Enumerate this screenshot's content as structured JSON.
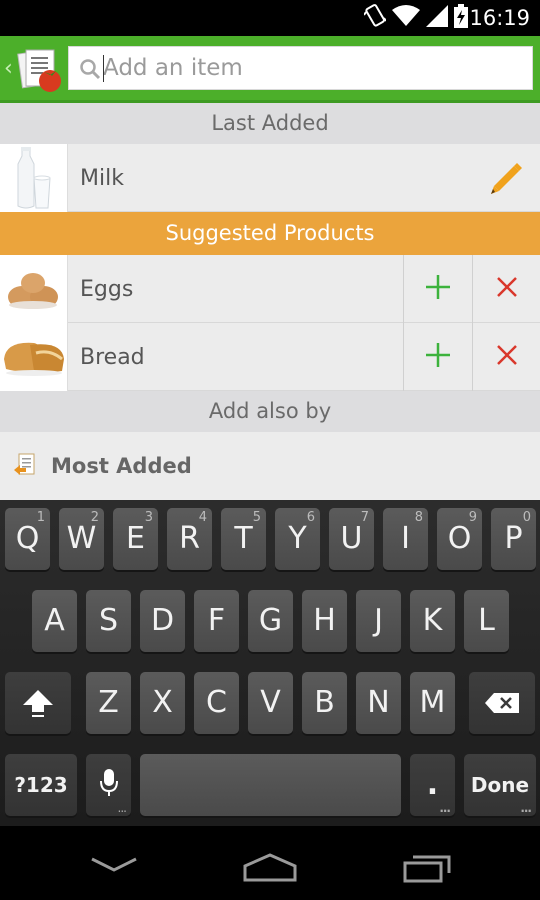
{
  "status_bar": {
    "time": "16:19",
    "icons": [
      "vibrate-icon",
      "wifi-icon",
      "signal-icon",
      "battery-icon"
    ]
  },
  "app_bar": {
    "search": {
      "placeholder": "Add an item",
      "value": ""
    }
  },
  "sections": {
    "last_added": {
      "title": "Last Added",
      "items": [
        {
          "label": "Milk",
          "image": "milk-image"
        }
      ]
    },
    "suggested": {
      "title": "Suggested Products",
      "items": [
        {
          "label": "Eggs",
          "image": "eggs-image"
        },
        {
          "label": "Bread",
          "image": "bread-image"
        }
      ]
    },
    "add_also": {
      "title": "Add also by",
      "items": [
        {
          "label": "Most Added"
        }
      ]
    }
  },
  "keyboard": {
    "row1": [
      {
        "key": "Q",
        "hint": "1"
      },
      {
        "key": "W",
        "hint": "2"
      },
      {
        "key": "E",
        "hint": "3"
      },
      {
        "key": "R",
        "hint": "4"
      },
      {
        "key": "T",
        "hint": "5"
      },
      {
        "key": "Y",
        "hint": "6"
      },
      {
        "key": "U",
        "hint": "7"
      },
      {
        "key": "I",
        "hint": "8"
      },
      {
        "key": "O",
        "hint": "9"
      },
      {
        "key": "P",
        "hint": "0"
      }
    ],
    "row2": [
      "A",
      "S",
      "D",
      "F",
      "G",
      "H",
      "J",
      "K",
      "L"
    ],
    "row3": [
      "Z",
      "X",
      "C",
      "V",
      "B",
      "N",
      "M"
    ],
    "symbols_label": "?123",
    "period_label": ".",
    "done_label": "Done"
  },
  "colors": {
    "app_bar": "#4caf2a",
    "suggested_header": "#eba43c",
    "add_icon": "#3cb23c",
    "remove_icon": "#d9372b",
    "edit_icon": "#f0a21c"
  }
}
